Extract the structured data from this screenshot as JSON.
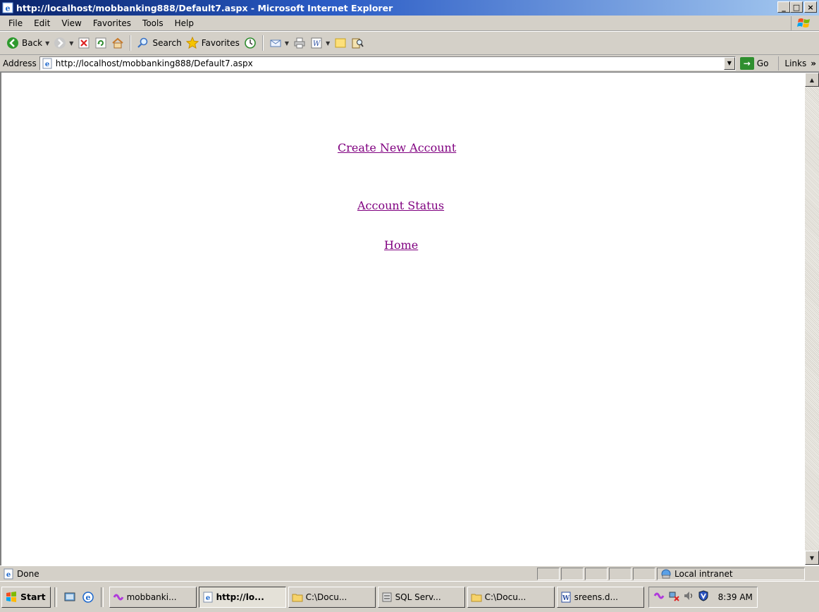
{
  "window": {
    "title": "http://localhost/mobbanking888/Default7.aspx - Microsoft Internet Explorer",
    "minimize": "_",
    "maximize": "□",
    "close": "×"
  },
  "menu": [
    {
      "label": "File"
    },
    {
      "label": "Edit"
    },
    {
      "label": "View"
    },
    {
      "label": "Favorites"
    },
    {
      "label": "Tools"
    },
    {
      "label": "Help"
    }
  ],
  "toolbar": {
    "back_label": "Back",
    "search_label": "Search",
    "favorites_label": "Favorites"
  },
  "address": {
    "label": "Address",
    "url": "http://localhost/mobbanking888/Default7.aspx",
    "go_label": "Go",
    "links_label": "Links"
  },
  "page": {
    "links": [
      {
        "label": "Create New Account"
      },
      {
        "label": "Account Status"
      },
      {
        "label": "Home"
      }
    ],
    "link_color": "#800080"
  },
  "status": {
    "text": "Done",
    "zone": "Local intranet"
  },
  "taskbar": {
    "start_label": "Start",
    "tasks": [
      {
        "label": "mobbanki...",
        "icon": "vs-icon",
        "active": false
      },
      {
        "label": "http://lo...",
        "icon": "ie-page-icon",
        "active": true
      },
      {
        "label": "C:\\Docu...",
        "icon": "folder-icon",
        "active": false
      },
      {
        "label": "SQL Serv...",
        "icon": "sql-server-icon",
        "active": false
      },
      {
        "label": "C:\\Docu...",
        "icon": "folder-icon",
        "active": false
      },
      {
        "label": "sreens.d...",
        "icon": "word-icon",
        "active": false
      }
    ],
    "clock": "8:39 AM"
  }
}
